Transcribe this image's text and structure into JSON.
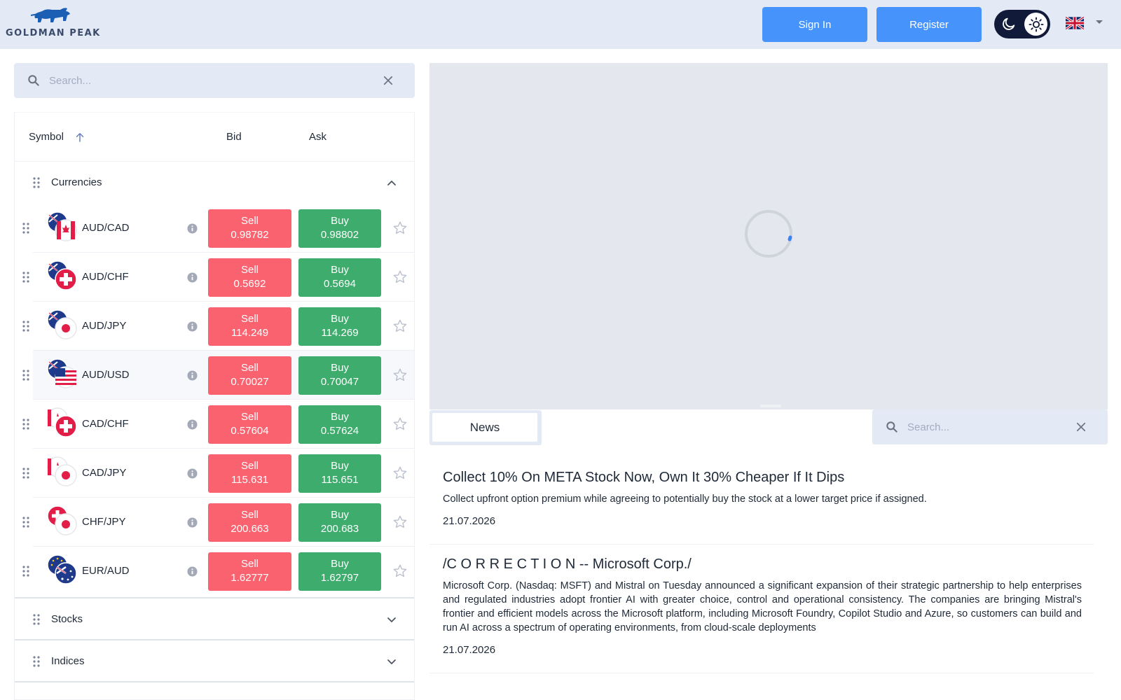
{
  "header": {
    "logo_text": "GOLDMAN PEAK",
    "sign_in_label": "Sign In",
    "register_label": "Register",
    "language": "en-GB"
  },
  "colors": {
    "accent": "#4694fb",
    "sell": "#fb626f",
    "buy": "#3dac6c",
    "header_bg": "#e4e9f6",
    "toggle_bg": "#121a3a"
  },
  "watchlist": {
    "search_placeholder": "Search...",
    "columns": {
      "symbol": "Symbol",
      "bid": "Bid",
      "ask": "Ask"
    },
    "groups": [
      {
        "name": "Currencies",
        "expanded": true,
        "rows": [
          {
            "symbol": "AUD/CAD",
            "sell_label": "Sell",
            "bid": "0.98782",
            "buy_label": "Buy",
            "ask": "0.98802"
          },
          {
            "symbol": "AUD/CHF",
            "sell_label": "Sell",
            "bid": "0.5692",
            "buy_label": "Buy",
            "ask": "0.5694"
          },
          {
            "symbol": "AUD/JPY",
            "sell_label": "Sell",
            "bid": "114.249",
            "buy_label": "Buy",
            "ask": "114.269"
          },
          {
            "symbol": "AUD/USD",
            "sell_label": "Sell",
            "bid": "0.70027",
            "buy_label": "Buy",
            "ask": "0.70047"
          },
          {
            "symbol": "CAD/CHF",
            "sell_label": "Sell",
            "bid": "0.57604",
            "buy_label": "Buy",
            "ask": "0.57624"
          },
          {
            "symbol": "CAD/JPY",
            "sell_label": "Sell",
            "bid": "115.631",
            "buy_label": "Buy",
            "ask": "115.651"
          },
          {
            "symbol": "CHF/JPY",
            "sell_label": "Sell",
            "bid": "200.663",
            "buy_label": "Buy",
            "ask": "200.683"
          },
          {
            "symbol": "EUR/AUD",
            "sell_label": "Sell",
            "bid": "1.62777",
            "buy_label": "Buy",
            "ask": "1.62797"
          }
        ]
      },
      {
        "name": "Stocks",
        "expanded": false
      },
      {
        "name": "Indices",
        "expanded": false
      }
    ]
  },
  "news": {
    "tab_label": "News",
    "search_placeholder": "Search...",
    "items": [
      {
        "title": "Collect 10% On META Stock Now, Own It 30% Cheaper If It Dips",
        "summary": "Collect upfront option premium while agreeing to potentially buy the stock at a lower target price if assigned.",
        "date": "21.07.2026"
      },
      {
        "title": "/C O R R E C T I O N -- Microsoft Corp./",
        "summary": "Microsoft Corp. (Nasdaq: MSFT) and Mistral on Tuesday announced a significant expansion of their strategic partnership to help enterprises and regulated industries adopt frontier AI with greater choice, control and operational consistency. The companies are bringing Mistral's frontier and efficient models across the Microsoft platform, including Microsoft Foundry, Copilot Studio and Azure, so customers can build and run AI across a spectrum of operating environments, from cloud-scale deployments",
        "date": "21.07.2026"
      }
    ]
  }
}
